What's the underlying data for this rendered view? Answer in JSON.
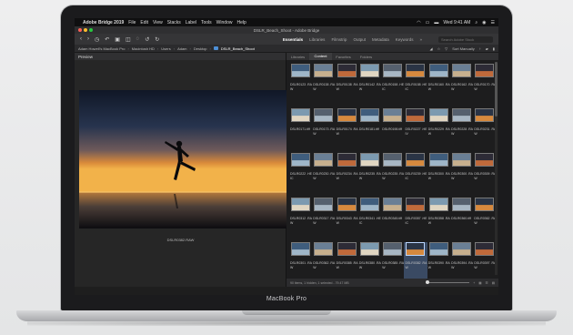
{
  "menubar": {
    "apple_icon": "",
    "app_name": "Adobe Bridge 2019",
    "items": [
      "File",
      "Edit",
      "View",
      "Stacks",
      "Label",
      "Tools",
      "Window",
      "Help"
    ],
    "clock": "Wed 9:41 AM"
  },
  "window": {
    "title": "DSLR_Beach_Shoot - Adobe Bridge"
  },
  "toolbar": {
    "workspaces": [
      "Essentials",
      "Libraries",
      "Filmstrip",
      "Output",
      "Metadata",
      "Keywords"
    ],
    "active_workspace": "Essentials",
    "search_placeholder": "Search Adobe Stock"
  },
  "path": {
    "crumbs": [
      "Adam Howell's MacBook Pro",
      "Macintosh HD",
      "Users",
      "Adam",
      "Desktop",
      "DSLR_Beach_Shoot"
    ],
    "sort_label": "Sort Manually"
  },
  "preview": {
    "tab": "Preview",
    "caption": "DSLR0382.RAW"
  },
  "content": {
    "tabs": [
      "Libraries",
      "Content",
      "Favorites",
      "Folders"
    ],
    "active_tab": "Content",
    "rows": [
      [
        "DSLR0123 .RAW",
        "DSLR0138 .RAW",
        "DSLR0138 .RAW",
        "DSLR0142 .RAW",
        "DSLR0158 .HEIC",
        "DSLR0158 .HEIC",
        "DSLR0160 .RAW",
        "DSLR0162 .RAW",
        "DSLR0170 .RAW"
      ],
      [
        "DSLR0171.tiff",
        "DSLR0173 .RAW",
        "DSLR0174 .RAW",
        "DSLR0181.tiff",
        "DSLR0198.tiff",
        "DSLR0227 .HEIV",
        "DSLR0229 .RAW",
        "DSLR0228 .RAW",
        "DSLR0231 .RAW"
      ],
      [
        "DSLR0222 .HEIC",
        "DSLR0230 .RAW",
        "DSLR0234 .RAW",
        "DSLR0235 .RAW",
        "DSLR0235 .RAW",
        "DSLR0239 .HEIC",
        "DSLR0300 .RAW",
        "DSLR0300 .RAW",
        "DSLR0309 .RAW"
      ],
      [
        "DSLR0312 .RAW",
        "DSLR0317 .RAW",
        "DSLR0343 .RAW",
        "DSLR0341 .HEIC",
        "DSLR0345.tiff",
        "DSLR0357 .HEIC",
        "DSLR0358 .RAW",
        "DSLR0360.tiff",
        "DSLR0362 .RAW"
      ],
      [
        "DSLR0301 .RAW",
        "DSLR0362 .RAW",
        "DSLR0385 .RAW",
        "DSLR0380 .RAW",
        "DSLR0385 .RAW",
        "DSLR0382 .RAW",
        "DSLR0390 .RAW",
        "DSLR0394 .RAW",
        "DSLR0397 .RAW"
      ]
    ],
    "status": "90 items, 1 hidden, 1 selected - 79.47 MB"
  },
  "laptop": {
    "brand": "MacBook Pro"
  },
  "colors": {
    "accent": "#4d8fd6",
    "close": "#fe5f57",
    "minimize": "#febc2e",
    "zoom": "#28c840"
  }
}
